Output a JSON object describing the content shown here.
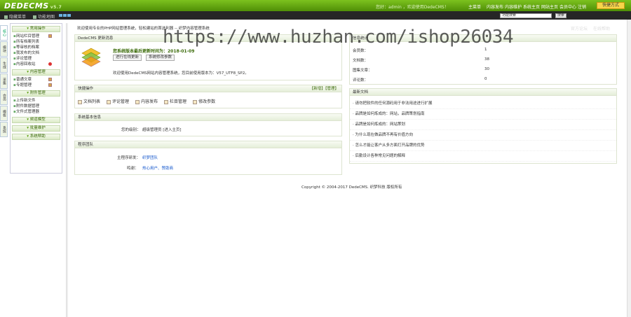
{
  "app": {
    "logo": "DEDECMS",
    "version": "v5.7"
  },
  "topbar": {
    "welcome": "您好：admin ，欢迎使用DedeCMS！",
    "nav": [
      "主菜单",
      "内容发布",
      "内容维护",
      "系统主页",
      "网站主页",
      "会员中心",
      "注销"
    ],
    "quick_btn": "快捷方式"
  },
  "subbar": {
    "left": [
      "隐藏菜单",
      "功能地图"
    ],
    "search_placeholder": "功能搜索",
    "search_btn": "搜索",
    "right": [
      "官方论坛",
      "在线帮助"
    ]
  },
  "vtabs": [
    "核心",
    "模块",
    "生成",
    "采集",
    "会员",
    "模板",
    "系统"
  ],
  "sidebar": {
    "sections": [
      {
        "title": "常用操作",
        "items": [
          {
            "label": "网站栏目管理",
            "mark": "add"
          },
          {
            "label": "所有档案列表",
            "mark": ""
          },
          {
            "label": "等审核的档案",
            "mark": ""
          },
          {
            "label": "我发布的文档",
            "mark": ""
          },
          {
            "label": "评论管理",
            "mark": ""
          },
          {
            "label": "内容回收站",
            "mark": "del"
          }
        ]
      },
      {
        "title": "内容管理",
        "items": [
          {
            "label": "普通文章",
            "mark": "add"
          },
          {
            "label": "专题管理",
            "mark": "add"
          }
        ]
      },
      {
        "title": "附件管理",
        "items": [
          {
            "label": "上传新文件",
            "mark": ""
          },
          {
            "label": "附件数据管理",
            "mark": ""
          },
          {
            "label": "文件式管理器",
            "mark": ""
          }
        ]
      },
      {
        "title": "频道模型",
        "items": []
      },
      {
        "title": "批量维护",
        "items": []
      },
      {
        "title": "系统帮助",
        "items": []
      }
    ]
  },
  "breadcrumb": "欢迎使用专业的PHP网站管理系统，轻松建站的首选利器 -- 织梦内容管理系统",
  "update_panel": {
    "title": "DedeCMS 更新消息",
    "headline": "您系统版本最后更新时间为：2018-01-09",
    "btn_check": "进行在线更新",
    "btn_mod": "系统修改参数",
    "desc": "欢迎使用DedeCMS网站内容管理系统，您目前使用版本为：V57_UTF8_SP2。"
  },
  "quick_panel": {
    "title": "快捷操作",
    "actions": "【新增】【管理】",
    "items": [
      "文档列表",
      "评论管理",
      "内容发布",
      "栏目管理",
      "修改参数"
    ]
  },
  "basic_panel": {
    "title": "系统基本信息",
    "label": "您的级别：",
    "value": "超级管理员 [进入主页]"
  },
  "dev_panel": {
    "title": "程序团队",
    "rows": [
      {
        "label": "主程序研发：",
        "value": "织梦团队"
      },
      {
        "label": "鸣谢：",
        "value": "热心用户、赞助商"
      }
    ]
  },
  "stats_panel": {
    "title": "信息统计",
    "rows": [
      {
        "label": "会员数：",
        "value": "1"
      },
      {
        "label": "文档数：",
        "value": "38"
      },
      {
        "label": "图集文章：",
        "value": "30"
      },
      {
        "label": "评论数：",
        "value": "0"
      }
    ]
  },
  "latest_panel": {
    "title": "最新文档",
    "items": [
      "请勿把软件的任何源码用于非法用途进行扩展",
      "品牌是如何炼成的：网站，品牌策划指南",
      "品牌是如何炼成的：网站策划",
      "为什么现在做品牌不再有价值方向",
      "怎么才能让客户从多方面打开品牌的优势",
      "后勤设计各种常见问题的解释"
    ]
  },
  "footer": "Copyright © 2004-2017 DedeCMS. 织梦科技 版权所有",
  "watermark": "https://www.huzhan.com/ishop26034"
}
